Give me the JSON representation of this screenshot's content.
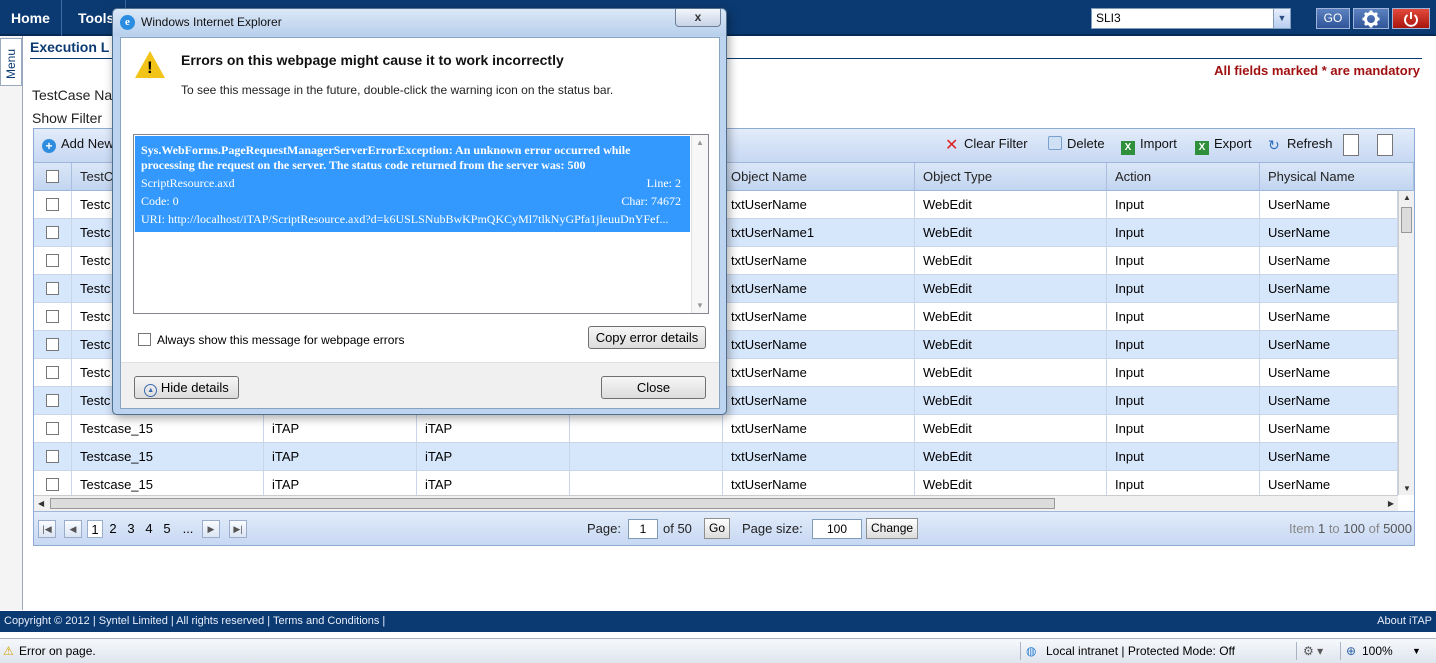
{
  "nav": {
    "home": "Home",
    "tools": "Tools"
  },
  "top": {
    "env_value": "SLI3",
    "go_label": "GO"
  },
  "menu": {
    "label": "Menu"
  },
  "page": {
    "title": "Execution L",
    "mandatory": "All fields marked * are mandatory",
    "testcase_label": "TestCase Na",
    "show_filter": "Show Filter"
  },
  "toolbar": {
    "add_new": "Add New",
    "clear_filter": "Clear Filter",
    "delete": "Delete",
    "import": "Import",
    "export": "Export",
    "refresh": "Refresh"
  },
  "grid": {
    "headers": [
      "TestC",
      "",
      "",
      "",
      "Object Name",
      "Object Type",
      "Action",
      "Physical Name"
    ],
    "rows": [
      [
        "Testc",
        "",
        "",
        "",
        "txtUserName",
        "WebEdit",
        "Input",
        "UserName"
      ],
      [
        "Testc",
        "",
        "",
        "",
        "txtUserName1",
        "WebEdit",
        "Input",
        "UserName"
      ],
      [
        "Testc",
        "",
        "",
        "",
        "txtUserName",
        "WebEdit",
        "Input",
        "UserName"
      ],
      [
        "Testc",
        "",
        "",
        "",
        "txtUserName",
        "WebEdit",
        "Input",
        "UserName"
      ],
      [
        "Testc",
        "",
        "",
        "",
        "txtUserName",
        "WebEdit",
        "Input",
        "UserName"
      ],
      [
        "Testc",
        "",
        "",
        "",
        "txtUserName",
        "WebEdit",
        "Input",
        "UserName"
      ],
      [
        "Testc",
        "",
        "",
        "",
        "txtUserName",
        "WebEdit",
        "Input",
        "UserName"
      ],
      [
        "Testc",
        "",
        "",
        "",
        "txtUserName",
        "WebEdit",
        "Input",
        "UserName"
      ],
      [
        "Testcase_15",
        "iTAP",
        "iTAP",
        "",
        "txtUserName",
        "WebEdit",
        "Input",
        "UserName"
      ],
      [
        "Testcase_15",
        "iTAP",
        "iTAP",
        "",
        "txtUserName",
        "WebEdit",
        "Input",
        "UserName"
      ],
      [
        "Testcase_15",
        "iTAP",
        "iTAP",
        "",
        "txtUserName",
        "WebEdit",
        "Input",
        "UserName"
      ]
    ]
  },
  "pager": {
    "pages": [
      "1",
      "2",
      "3",
      "4",
      "5",
      "..."
    ],
    "page_label": "Page:",
    "page_value": "1",
    "of_pages": "of 50",
    "go": "Go",
    "size_label": "Page size:",
    "size_value": "100",
    "change": "Change",
    "item_word": "Item",
    "item_from": "1",
    "to_word": "to",
    "item_to": "100",
    "of_word": "of",
    "item_total": "5000"
  },
  "footer": {
    "left": "Copyright © 2012 | Syntel Limited | All rights reserved | Terms and Conditions |",
    "right": "About iTAP"
  },
  "statusbar": {
    "error": "Error on page.",
    "zone": "Local intranet | Protected Mode: Off",
    "zoom": "100%"
  },
  "dialog": {
    "title": "Windows Internet Explorer",
    "close_x": "x",
    "heading": "Errors on this webpage might cause it to work incorrectly",
    "sub": "To see this message in the future, double-click the warning icon on the status bar.",
    "error_message": "Sys.WebForms.PageRequestManagerServerErrorException: An unknown error occurred while processing the request on the server. The status code returned from the server was: 500",
    "file": "ScriptResource.axd",
    "line": "Line: 2",
    "code": "Code: 0",
    "char": "Char: 74672",
    "uri": "URI: http://localhost/iTAP/ScriptResource.axd?d=k6USLSNubBwKPmQKCyMl7tlkNyGPfa1jleuuDnYFef...",
    "always_show": "Always show this message for webpage errors",
    "copy_details": "Copy error details",
    "hide_details": "Hide details",
    "close": "Close"
  },
  "colors": {
    "nav_bg": "#0b3a72",
    "row_alt": "#d6e6fb",
    "selection": "#3399ff",
    "mandatory": "#a01010"
  }
}
